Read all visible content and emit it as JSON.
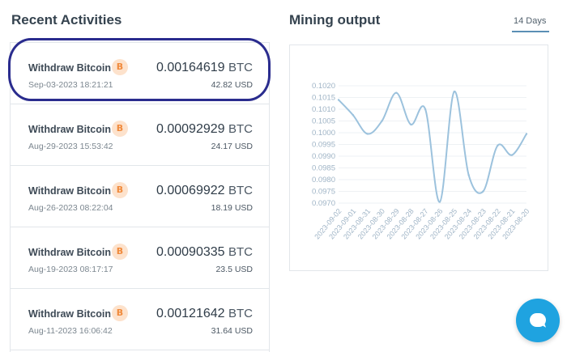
{
  "recent": {
    "title": "Recent Activities",
    "items": [
      {
        "label": "Withdraw Bitcoin",
        "date": "Sep-03-2023 18:21:21",
        "amount": "0.00164619",
        "currency": "BTC",
        "usd": "42.82 USD",
        "icon": "bitcoin-icon",
        "badge": "B"
      },
      {
        "label": "Withdraw Bitcoin",
        "date": "Aug-29-2023 15:53:42",
        "amount": "0.00092929",
        "currency": "BTC",
        "usd": "24.17 USD",
        "icon": "bitcoin-icon",
        "badge": "B"
      },
      {
        "label": "Withdraw Bitcoin",
        "date": "Aug-26-2023 08:22:04",
        "amount": "0.00069922",
        "currency": "BTC",
        "usd": "18.19 USD",
        "icon": "bitcoin-icon",
        "badge": "B"
      },
      {
        "label": "Withdraw Bitcoin",
        "date": "Aug-19-2023 08:17:17",
        "amount": "0.00090335",
        "currency": "BTC",
        "usd": "23.5 USD",
        "icon": "bitcoin-icon",
        "badge": "B"
      },
      {
        "label": "Withdraw Bitcoin",
        "date": "Aug-11-2023 16:06:42",
        "amount": "0.00121642",
        "currency": "BTC",
        "usd": "31.64 USD",
        "icon": "bitcoin-icon",
        "badge": "B"
      }
    ]
  },
  "mining": {
    "title": "Mining output",
    "range_label": "14 Days"
  },
  "chart_data": {
    "type": "line",
    "title": "",
    "xlabel": "",
    "ylabel": "",
    "ylim": [
      0.097,
      0.102
    ],
    "y_ticks": [
      "0.1020",
      "0.1015",
      "0.1010",
      "0.1005",
      "0.1000",
      "0.0995",
      "0.0990",
      "0.0985",
      "0.0980",
      "0.0975",
      "0.0970"
    ],
    "grid": true,
    "line_color": "#9cc2dd",
    "x": [
      "2023-09-02",
      "2023-09-01",
      "2023-08-31",
      "2023-08-30",
      "2023-08-29",
      "2023-08-28",
      "2023-08-27",
      "2023-08-26",
      "2023-08-25",
      "2023-08-24",
      "2023-08-23",
      "2023-08-22",
      "2023-08-21",
      "2023-08-20"
    ],
    "values": [
      0.1014,
      0.10075,
      0.09995,
      0.1005,
      0.1017,
      0.10035,
      0.101,
      0.09705,
      0.10175,
      0.0982,
      0.0975,
      0.09945,
      0.09905,
      0.09995
    ]
  },
  "colors": {
    "highlight": "#2a2c8e",
    "btc_badge_bg": "#fde2cc",
    "btc_badge_fg": "#f08a3c",
    "chat_fab": "#1fa3e0",
    "tab_underline": "#5b8fb5"
  },
  "chat": {
    "icon": "chat-bubble-icon"
  }
}
